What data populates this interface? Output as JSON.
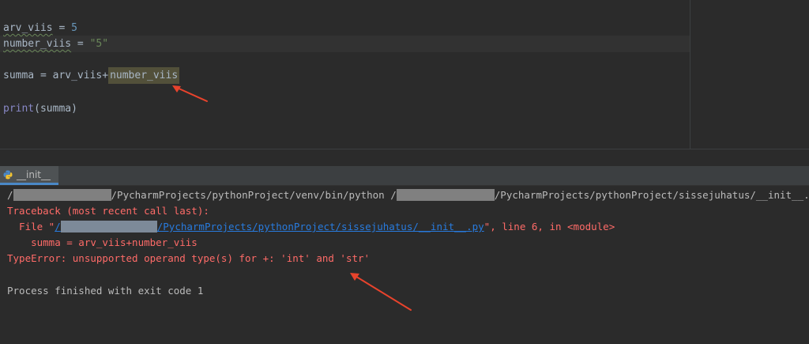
{
  "editor": {
    "line1": {
      "var": "arv_viis",
      "op": " = ",
      "value": "5"
    },
    "line2": {
      "var": "number_viis",
      "op": " = ",
      "value": "\"5\""
    },
    "line3": {
      "left": "summa = arv_viis+",
      "highlighted": "number_viis"
    },
    "line4": {
      "func": "print",
      "args": "(summa)"
    }
  },
  "run_panel": {
    "tab_label": "__init__"
  },
  "console": {
    "cmd_slash": "/",
    "cmd_part1": "/PycharmProjects/pythonProject/venv/bin/python /",
    "cmd_part2": "/PycharmProjects/pythonProject/sissejuhatus/__init__.py",
    "traceback_header": "Traceback (most recent call last):",
    "file_prefix": "  File \"",
    "file_link_slash": "/",
    "file_link": "/PycharmProjects/pythonProject/sissejuhatus/__init__.py",
    "file_suffix": "\", line 6, in <module>",
    "code_line": "    summa = arv_viis+number_viis",
    "error_line": "TypeError: unsupported operand type(s) for +: 'int' and 'str'",
    "exit_line": "Process finished with exit code 1"
  },
  "colors": {
    "arrow": "#e8432c",
    "error": "#ff6b68",
    "link": "#287bde"
  }
}
